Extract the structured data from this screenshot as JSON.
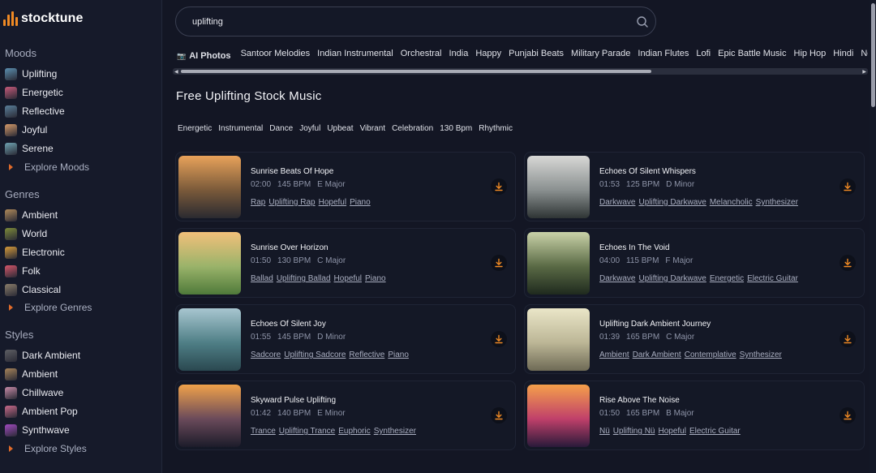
{
  "brand": "stocktune",
  "sidebar": {
    "moods_title": "Moods",
    "moods": [
      {
        "label": "Uplifting",
        "color": "#5b8fb0"
      },
      {
        "label": "Energetic",
        "color": "#c65a7a"
      },
      {
        "label": "Reflective",
        "color": "#5a7f9a"
      },
      {
        "label": "Joyful",
        "color": "#d59a6a"
      },
      {
        "label": "Serene",
        "color": "#6fa3b2"
      }
    ],
    "explore_moods": "Explore Moods",
    "genres_title": "Genres",
    "genres": [
      {
        "label": "Ambient",
        "color": "#b08a5a"
      },
      {
        "label": "World",
        "color": "#7d8b3a"
      },
      {
        "label": "Electronic",
        "color": "#d69a3a"
      },
      {
        "label": "Folk",
        "color": "#d6566a"
      },
      {
        "label": "Classical",
        "color": "#8a7d6a"
      }
    ],
    "explore_genres": "Explore Genres",
    "styles_title": "Styles",
    "styles": [
      {
        "label": "Dark Ambient",
        "color": "#5e5f64"
      },
      {
        "label": "Ambient",
        "color": "#a8845a"
      },
      {
        "label": "Chillwave",
        "color": "#c68aa6"
      },
      {
        "label": "Ambient Pop",
        "color": "#c86a8a"
      },
      {
        "label": "Synthwave",
        "color": "#a04ac0"
      }
    ],
    "explore_styles": "Explore Styles"
  },
  "search": {
    "value": "uplifting"
  },
  "chips": [
    "AI Photos",
    "Santoor Melodies",
    "Indian Instrumental",
    "Orchestral",
    "India",
    "Happy",
    "Punjabi Beats",
    "Military Parade",
    "Indian Flutes",
    "Lofi",
    "Epic Battle Music",
    "Hip Hop",
    "Hindi",
    "Nostalgic"
  ],
  "page_title": "Free Uplifting Stock Music",
  "tags": [
    "Energetic",
    "Instrumental",
    "Dance",
    "Joyful",
    "Upbeat",
    "Vibrant",
    "Celebration",
    "130 Bpm",
    "Rhythmic"
  ],
  "tracks": [
    {
      "title": "Sunrise Beats Of Hope",
      "duration": "02:00",
      "bpm": "145 BPM",
      "key": "E Major",
      "tags": [
        "Rap",
        "Uplifting Rap",
        "Hopeful",
        "Piano"
      ],
      "art": [
        "#e8a25a",
        "#7a5a3a",
        "#2a2a30"
      ]
    },
    {
      "title": "Echoes Of Silent Whispers",
      "duration": "01:53",
      "bpm": "125 BPM",
      "key": "D Minor",
      "tags": [
        "Darkwave",
        "Uplifting Darkwave",
        "Melancholic",
        "Synthesizer"
      ],
      "art": [
        "#d8d8d6",
        "#8a9090",
        "#2e3434"
      ]
    },
    {
      "title": "Sunrise Over Horizon",
      "duration": "01:50",
      "bpm": "130 BPM",
      "key": "C Major",
      "tags": [
        "Ballad",
        "Uplifting Ballad",
        "Hopeful",
        "Piano"
      ],
      "art": [
        "#f2c07a",
        "#9ab36a",
        "#4f7a3a"
      ]
    },
    {
      "title": "Echoes In The Void",
      "duration": "04:00",
      "bpm": "115 BPM",
      "key": "F Major",
      "tags": [
        "Darkwave",
        "Uplifting Darkwave",
        "Energetic",
        "Electric Guitar"
      ],
      "art": [
        "#c9d2a8",
        "#5a6a45",
        "#1f2a1e"
      ]
    },
    {
      "title": "Echoes Of Silent Joy",
      "duration": "01:55",
      "bpm": "145 BPM",
      "key": "D Minor",
      "tags": [
        "Sadcore",
        "Uplifting Sadcore",
        "Reflective",
        "Piano"
      ],
      "art": [
        "#a8c6d0",
        "#4f7f86",
        "#2a4850"
      ]
    },
    {
      "title": "Uplifting Dark Ambient Journey",
      "duration": "01:39",
      "bpm": "165 BPM",
      "key": "C Major",
      "tags": [
        "Ambient",
        "Dark Ambient",
        "Contemplative",
        "Synthesizer"
      ],
      "art": [
        "#eae6c8",
        "#bcb696",
        "#6e6a55"
      ]
    },
    {
      "title": "Skyward Pulse Uplifting",
      "duration": "01:42",
      "bpm": "140 BPM",
      "key": "E Minor",
      "tags": [
        "Trance",
        "Uplifting Trance",
        "Euphoric",
        "Synthesizer"
      ],
      "art": [
        "#f0a24a",
        "#6a4a5a",
        "#1c1c2a"
      ]
    },
    {
      "title": "Rise Above The Noise",
      "duration": "01:50",
      "bpm": "165 BPM",
      "key": "B Major",
      "tags": [
        "Nü",
        "Uplifting Nü",
        "Hopeful",
        "Electric Guitar"
      ],
      "art": [
        "#f5a04a",
        "#c0406a",
        "#2a1a3a"
      ]
    }
  ]
}
